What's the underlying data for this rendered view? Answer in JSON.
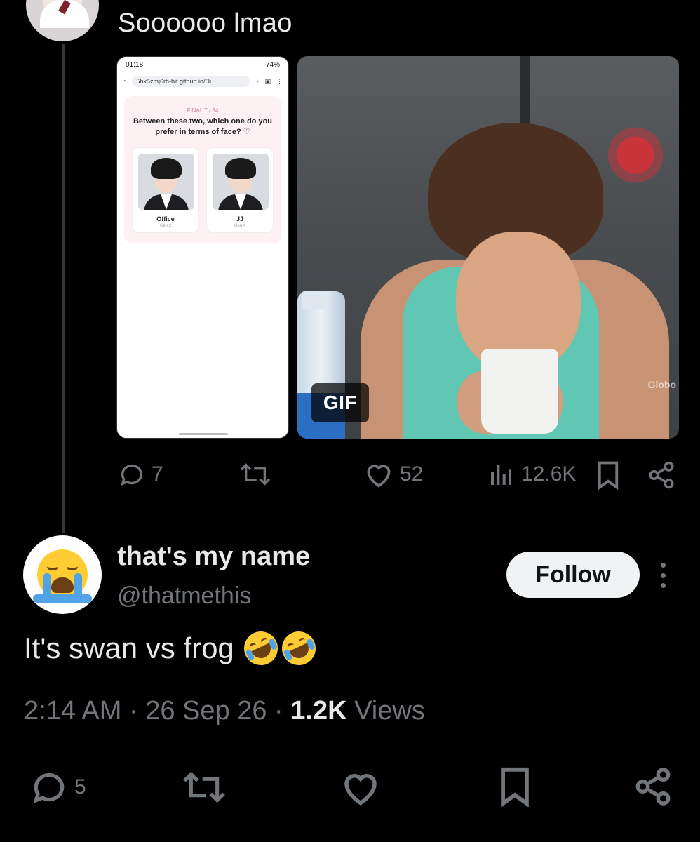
{
  "parent_post": {
    "text": "Soooooo lmao",
    "screenshot": {
      "status_time": "01:18",
      "battery": "74%",
      "url": "5hk5zmj6rh-bit.github.io/Di",
      "quiz_tag": "FINAL 7 / 54",
      "question": "Between these two, which one do you prefer in terms of face? ♡",
      "choices": [
        {
          "name": "Office",
          "gen": "Gen 2"
        },
        {
          "name": "JJ",
          "gen": "Gen 4"
        }
      ]
    },
    "gif_badge": "GIF",
    "gif_watermark": "Globo",
    "stats": {
      "replies": "7",
      "retweets": "",
      "likes": "52",
      "views": "12.6K"
    }
  },
  "reply": {
    "display_name": "that's my name",
    "handle": "@thatmethis",
    "follow_label": "Follow",
    "text": "It's swan vs frog",
    "time": "2:14 AM",
    "date": "26 Sep 26",
    "views_count": "1.2K",
    "views_label": "Views",
    "stats": {
      "replies": "5"
    }
  },
  "colors": {
    "background": "#000000",
    "text": "#e7e9ea",
    "muted": "#71767b",
    "follow_bg": "#eff3f4"
  },
  "icons": [
    "reply-icon",
    "retweet-icon",
    "like-icon",
    "views-icon",
    "bookmark-icon",
    "share-icon",
    "more-icon"
  ]
}
